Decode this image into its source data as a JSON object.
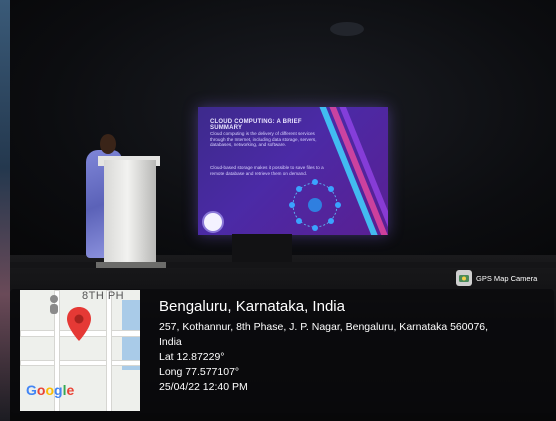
{
  "slide": {
    "title": "CLOUD COMPUTING: A BRIEF SUMMARY",
    "bullet_1": "Cloud computing is the delivery of different services through the Internet, including data storage, servers, databases, networking, and software.",
    "bullet_2": "Cloud-based storage makes it possible to save files to a remote database and retrieve them on demand."
  },
  "gps_badge": {
    "label": "GPS Map Camera",
    "icon": "camera-app-icon"
  },
  "map": {
    "street_label": "8TH PH",
    "logo_text": "Google",
    "pin_icon": "location-pin-icon",
    "person_icon": "street-view-person-icon"
  },
  "location": {
    "title": "Bengaluru, Karnataka, India",
    "address_line1": "257, Kothannur, 8th Phase, J. P. Nagar, Bengaluru, Karnataka 560076,",
    "address_line2": "India",
    "lat": "Lat 12.87229°",
    "long": "Long 77.577107°",
    "datetime": "25/04/22 12:40 PM"
  },
  "colors": {
    "slide_bg": "#4b2aa6",
    "pin": "#e53935",
    "overlay_bg": "#0a0a0c"
  }
}
